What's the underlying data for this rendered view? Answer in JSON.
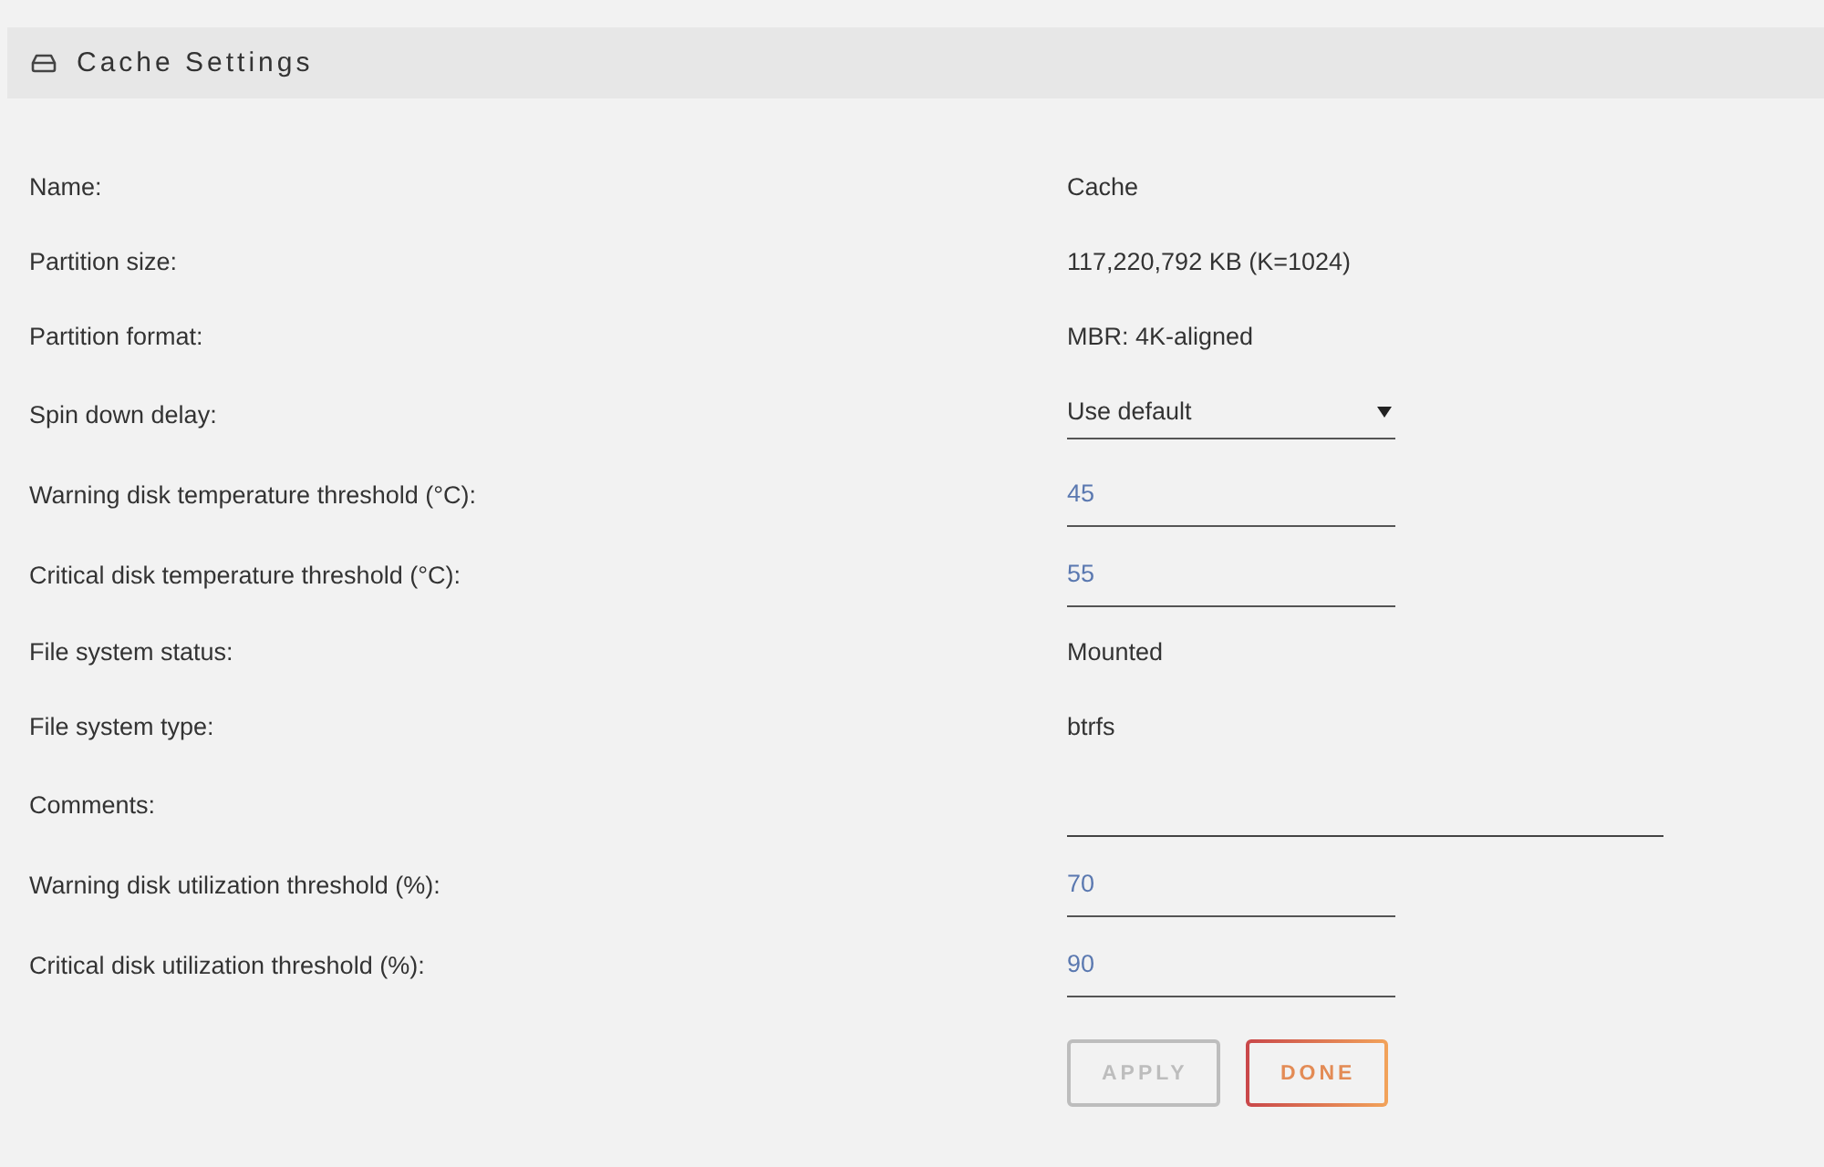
{
  "header": {
    "title": "Cache Settings"
  },
  "rows": [
    {
      "label": "Name:",
      "kind": "text",
      "value": "Cache"
    },
    {
      "label": "Partition size:",
      "kind": "text",
      "value": "117,220,792 KB (K=1024)"
    },
    {
      "label": "Partition format:",
      "kind": "text",
      "value": "MBR: 4K-aligned"
    },
    {
      "label": "Spin down delay:",
      "kind": "select",
      "value": "Use default"
    },
    {
      "label": "Warning disk temperature threshold (°C):",
      "kind": "number",
      "value": "45"
    },
    {
      "label": "Critical disk temperature threshold (°C):",
      "kind": "number",
      "value": "55"
    },
    {
      "label": "File system status:",
      "kind": "text",
      "value": "Mounted"
    },
    {
      "label": "File system type:",
      "kind": "text",
      "value": "btrfs"
    },
    {
      "label": "Comments:",
      "kind": "textarea"
    },
    {
      "label": "Warning disk utilization threshold (%):",
      "kind": "number",
      "value": "70"
    },
    {
      "label": "Critical disk utilization threshold (%):",
      "kind": "number",
      "value": "90"
    }
  ],
  "buttons": [
    {
      "label": "APPLY",
      "disabled": true
    },
    {
      "label": "DONE",
      "disabled": false
    }
  ]
}
